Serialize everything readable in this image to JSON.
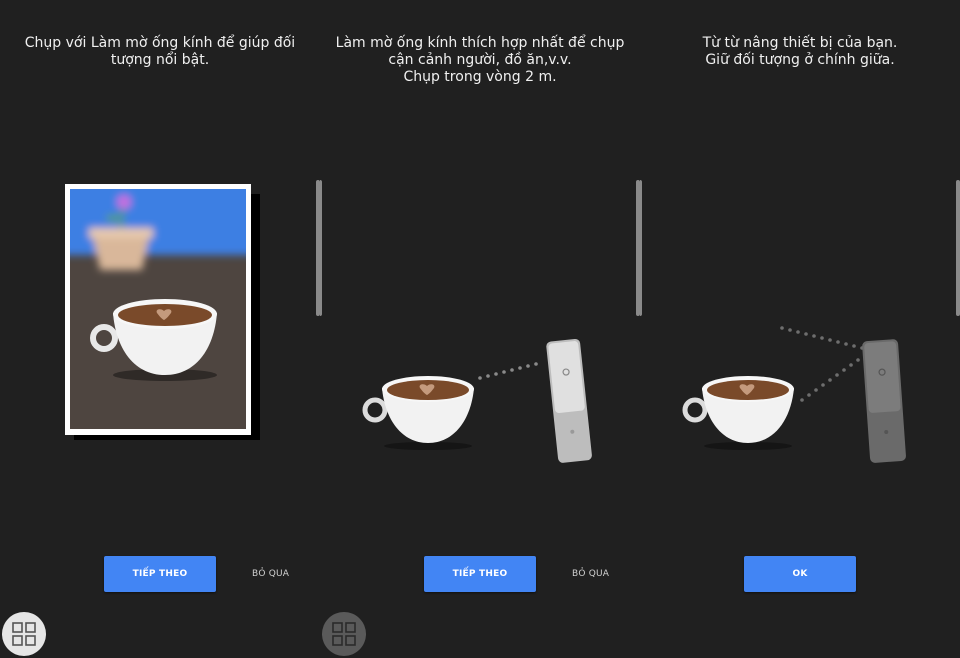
{
  "panels": [
    {
      "instruction_lines": [
        "Chụp với Làm mờ ống kính để giúp đối",
        "tượng nổi bật."
      ],
      "primary_button": "TIẾP THEO",
      "secondary_button": "BỎ QUA"
    },
    {
      "instruction_lines": [
        "Làm mờ ống kính thích hợp nhất để chụp",
        "cận cảnh người, đồ ăn,v.v.",
        "Chụp trong vòng 2 m."
      ],
      "primary_button": "TIẾP THEO",
      "secondary_button": "BỎ QUA"
    },
    {
      "instruction_lines": [
        "Từ từ nâng thiết bị của bạn.",
        "Giữ đối tượng ở chính giữa."
      ],
      "primary_button": "OK"
    }
  ],
  "colors": {
    "background": "#202020",
    "accent": "#4285f4",
    "sky": "#3e7fe3",
    "table": "#4e4540",
    "coffee": "#7a4a2a",
    "cup": "#f2f2f2"
  },
  "icons": [
    "mode-grid-icon",
    "coffee-cup-illustration",
    "phone-illustration",
    "blurred-photo-card"
  ]
}
